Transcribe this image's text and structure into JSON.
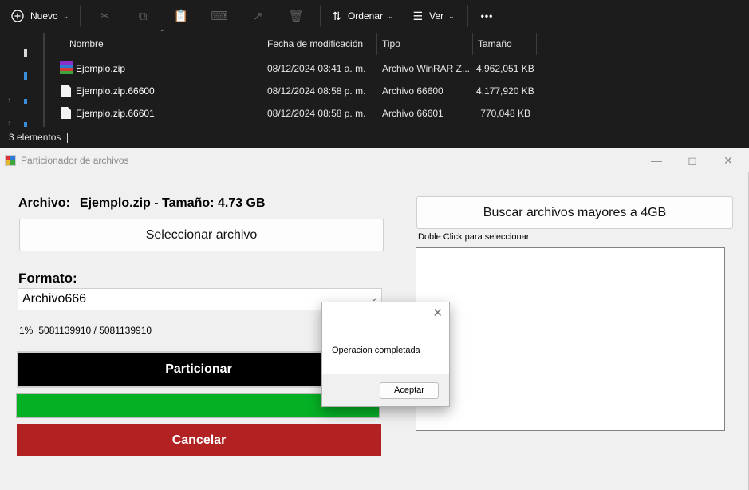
{
  "explorer": {
    "toolbar": {
      "new_label": "Nuevo",
      "sort_label": "Ordenar",
      "view_label": "Ver",
      "more_label": "•••"
    },
    "columns": {
      "name": "Nombre",
      "date": "Fecha de modificación",
      "type": "Tipo",
      "size": "Tamaño"
    },
    "files": [
      {
        "name": "Ejemplo.zip",
        "date": "08/12/2024 03:41 a. m.",
        "type": "Archivo WinRAR Z...",
        "size": "4,962,051 KB",
        "icon": "winrar-icon"
      },
      {
        "name": "Ejemplo.zip.66600",
        "date": "08/12/2024 08:58 p. m.",
        "type": "Archivo 66600",
        "size": "4,177,920 KB",
        "icon": "file-icon"
      },
      {
        "name": "Ejemplo.zip.66601",
        "date": "08/12/2024 08:58 p. m.",
        "type": "Archivo 66601",
        "size": "770,048 KB",
        "icon": "file-icon"
      }
    ],
    "status": "3 elementos"
  },
  "window": {
    "title": "Particionador de archivos",
    "file_label": "Archivo:",
    "file_info": "Ejemplo.zip - Tamaño: 4.73 GB",
    "select_button": "Seleccionar archivo",
    "format_label": "Formato:",
    "format_value": "Archivo666",
    "progress_percent": "1%",
    "progress_bytes": "5081139910 / 5081139910",
    "progress_fraction": 1.0,
    "partition_button": "Particionar",
    "cancel_button": "Cancelar",
    "search_button": "Buscar archivos mayores a 4GB",
    "hint": "Doble Click para seleccionar",
    "colors": {
      "progress": "#06b025",
      "cancel": "#b22222",
      "partition": "#000000"
    }
  },
  "dialog": {
    "message": "Operacion completada",
    "ok_button": "Aceptar"
  }
}
